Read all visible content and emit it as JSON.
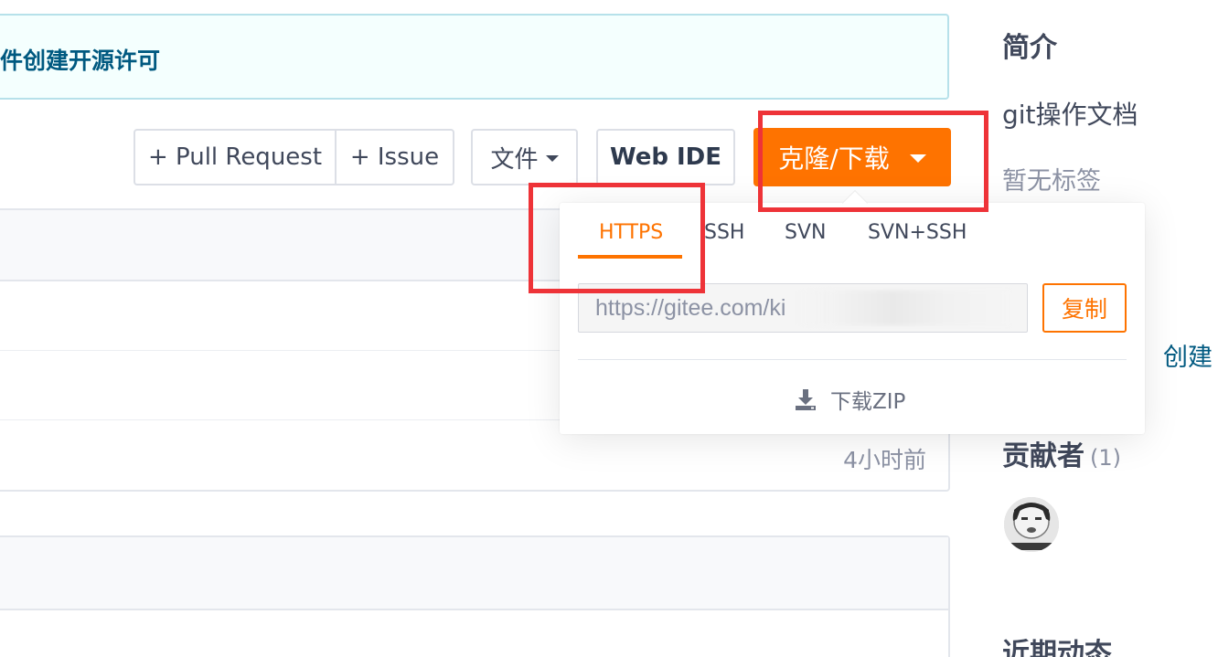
{
  "notice": {
    "text": "件创建开源许可"
  },
  "toolbar": {
    "pull_request": "+ Pull Request",
    "issue": "+ Issue",
    "file": "文件",
    "web_ide": "Web IDE",
    "clone_download": "克隆/下载"
  },
  "file_list": {
    "last_updated": "4小时前"
  },
  "sidebar": {
    "intro_title": "简介",
    "description": "git操作文档",
    "tags_empty": "暂无标签",
    "create_link": "创建",
    "contributors_title": "贡献者",
    "contributors_count": "(1)",
    "activity_title": "近期动态"
  },
  "clone_popup": {
    "tabs": [
      {
        "label": "HTTPS",
        "active": true
      },
      {
        "label": "SSH",
        "active": false
      },
      {
        "label": "SVN",
        "active": false
      },
      {
        "label": "SVN+SSH",
        "active": false
      }
    ],
    "url_value": "https://gitee.com/ki",
    "copy_label": "复制",
    "download_zip": "下载ZIP"
  },
  "colors": {
    "accent": "#fe7300",
    "link": "#005980",
    "highlight": "#ee3338"
  }
}
